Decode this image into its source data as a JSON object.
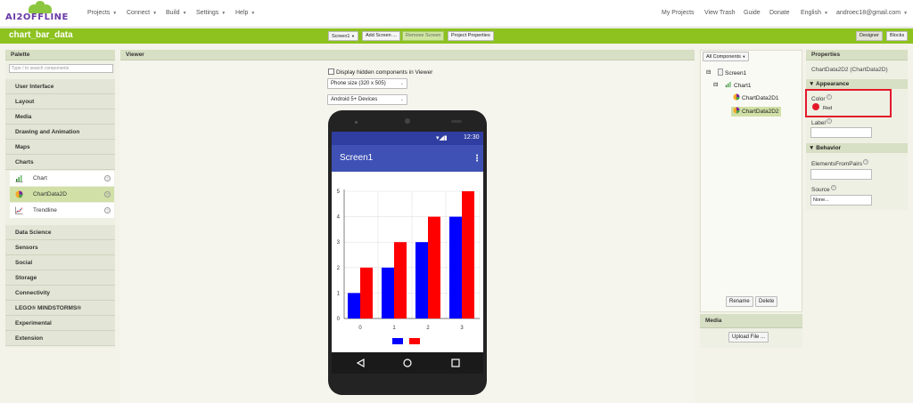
{
  "topbar": {
    "logo_text": "AI2OFFLINE",
    "menus": [
      "Projects",
      "Connect",
      "Build",
      "Settings",
      "Help"
    ],
    "right_links": [
      "My Projects",
      "View Trash",
      "Guide",
      "Donate",
      "English",
      "androec18@gmail.com"
    ]
  },
  "project": {
    "title": "chart_bar_data",
    "screen_select": "Screen1",
    "add_screen": "Add Screen ...",
    "remove_screen": "Remove Screen",
    "project_properties": "Project Properties",
    "designer": "Designer",
    "blocks": "Blocks"
  },
  "palette": {
    "header": "Palette",
    "search_placeholder": "Type / to search components",
    "categories_top": [
      "User Interface",
      "Layout",
      "Media",
      "Drawing and Animation",
      "Maps",
      "Charts"
    ],
    "chart_components": [
      "Chart",
      "ChartData2D",
      "Trendline"
    ],
    "categories_bottom": [
      "Data Science",
      "Sensors",
      "Social",
      "Storage",
      "Connectivity",
      "LEGO® MINDSTORMS®",
      "Experimental",
      "Extension"
    ]
  },
  "viewer": {
    "header": "Viewer",
    "hidden_label": "Display hidden components in Viewer",
    "size_select": "Phone size (320 x 505)",
    "device_select": "Android 5+ Devices",
    "status_time": "12:30",
    "screen_title": "Screen1"
  },
  "components": {
    "dropdown": "All Components",
    "tree": [
      "Screen1",
      "Chart1",
      "ChartData2D1",
      "ChartData2D2"
    ],
    "rename": "Rename",
    "delete": "Delete"
  },
  "media": {
    "header": "Media",
    "upload": "Upload File ..."
  },
  "properties": {
    "header": "Properties",
    "component_name": "ChartData2D2 (ChartData2D)",
    "appearance": "Appearance",
    "color_label": "Color",
    "color_value": "Red",
    "label_label": "Label",
    "behavior": "Behavior",
    "elements_label": "ElementsFromPairs",
    "source_label": "Source",
    "source_value": "None..."
  },
  "chart_data": {
    "type": "bar",
    "categories": [
      "0",
      "1",
      "2",
      "3"
    ],
    "series": [
      {
        "values": [
          1,
          2,
          3,
          4
        ],
        "color": "#0000ff"
      },
      {
        "values": [
          2,
          3,
          4,
          5
        ],
        "color": "#ff0000"
      }
    ],
    "y_ticks": [
      "0",
      "1",
      "2",
      "3",
      "4",
      "5"
    ],
    "ylim": [
      0,
      5
    ],
    "grid": true,
    "legend": "bottom"
  },
  "colors": {
    "accent_green": "#8dc21f",
    "app_bar": "#3f51b5",
    "highlight": "#e3192a"
  }
}
